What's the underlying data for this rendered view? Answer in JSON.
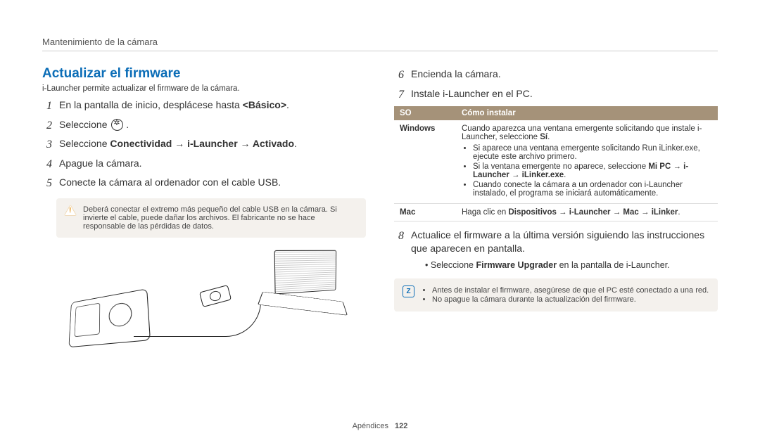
{
  "header": {
    "breadcrumb": "Mantenimiento de la cámara"
  },
  "section": {
    "title": "Actualizar el firmware",
    "intro": "i-Launcher permite actualizar el firmware de la cámara."
  },
  "stepsLeft": [
    {
      "n": "1",
      "html": "En la pantalla de inicio, desplácese hasta <b>&lt;Básico&gt;</b>."
    },
    {
      "n": "2",
      "html": "Seleccione "
    },
    {
      "n": "3",
      "html": "Seleccione <b>Conectividad → i-Launcher → Activado</b>."
    },
    {
      "n": "4",
      "html": "Apague la cámara."
    },
    {
      "n": "5",
      "html": "Conecte la cámara al ordenador con el cable USB."
    }
  ],
  "warning": "Deberá conectar el extremo más pequeño del cable USB en la cámara. Si invierte el cable, puede dañar los archivos. El fabricante no se hace responsable de las pérdidas de datos.",
  "stepsRight67": [
    {
      "n": "6",
      "html": "Encienda la cámara."
    },
    {
      "n": "7",
      "html": "Instale i-Launcher en el PC."
    }
  ],
  "table": {
    "head": {
      "os": "SO",
      "how": "Cómo instalar"
    },
    "rows": [
      {
        "os": "Windows",
        "lead": "Cuando aparezca una ventana emergente solicitando que instale i-Launcher, seleccione <b>Sí</b>.",
        "bullets": [
          "Si aparece una ventana emergente solicitando Run iLinker.exe, ejecute este archivo primero.",
          "Si la ventana emergente no aparece, seleccione <b>Mi PC → i-Launcher → iLinker.exe</b>.",
          "Cuando conecte la cámara a un ordenador con i-Launcher instalado, el programa se iniciará automáticamente."
        ]
      },
      {
        "os": "Mac",
        "lead": "Haga clic en <b>Dispositivos → i-Launcher → Mac → iLinker</b>.",
        "bullets": []
      }
    ]
  },
  "step8": {
    "n": "8",
    "html": "Actualice el firmware a la última versión siguiendo las instrucciones que aparecen en pantalla.",
    "sub": "Seleccione <b>Firmware Upgrader</b> en la pantalla de i-Launcher."
  },
  "note": {
    "items": [
      "Antes de instalar el firmware, asegúrese de que el PC esté conectado a una red.",
      "No apague la cámara durante la actualización del firmware."
    ]
  },
  "footer": {
    "section": "Apéndices",
    "page": "122"
  }
}
